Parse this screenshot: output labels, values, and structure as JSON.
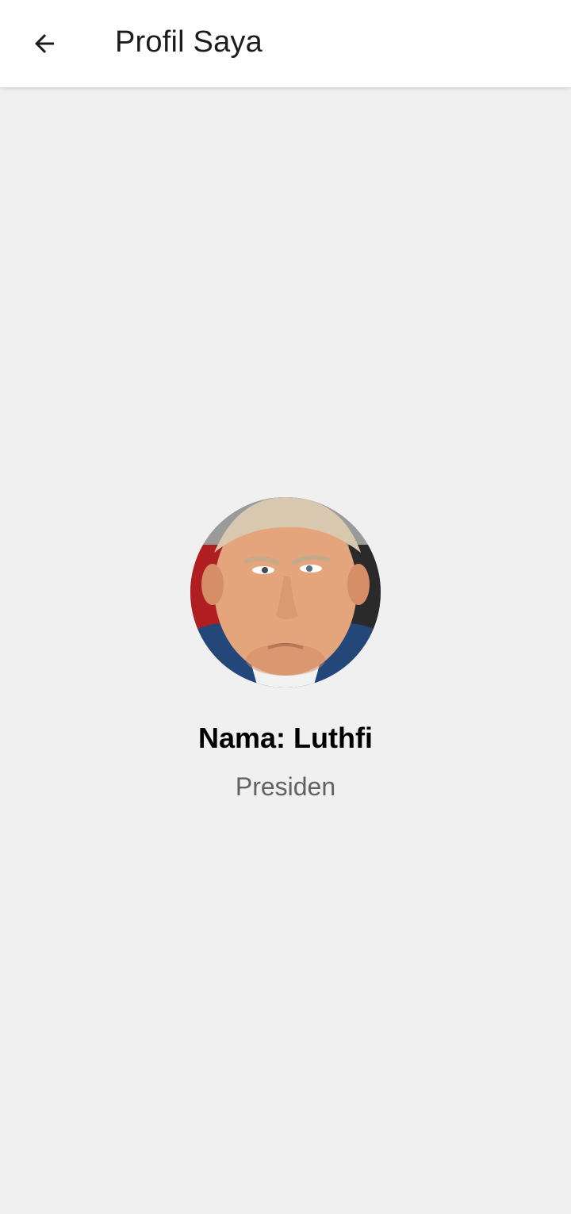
{
  "appbar": {
    "title": "Profil Saya",
    "back_icon": "arrow-back-icon"
  },
  "profile": {
    "avatar_icon": "profile-photo",
    "name": "Nama: Luthfi",
    "role": "Presiden"
  },
  "colors": {
    "background": "#f1f0f1",
    "appbar": "#ffffff",
    "title_text": "#1c1b1f",
    "role_text": "#616161"
  }
}
